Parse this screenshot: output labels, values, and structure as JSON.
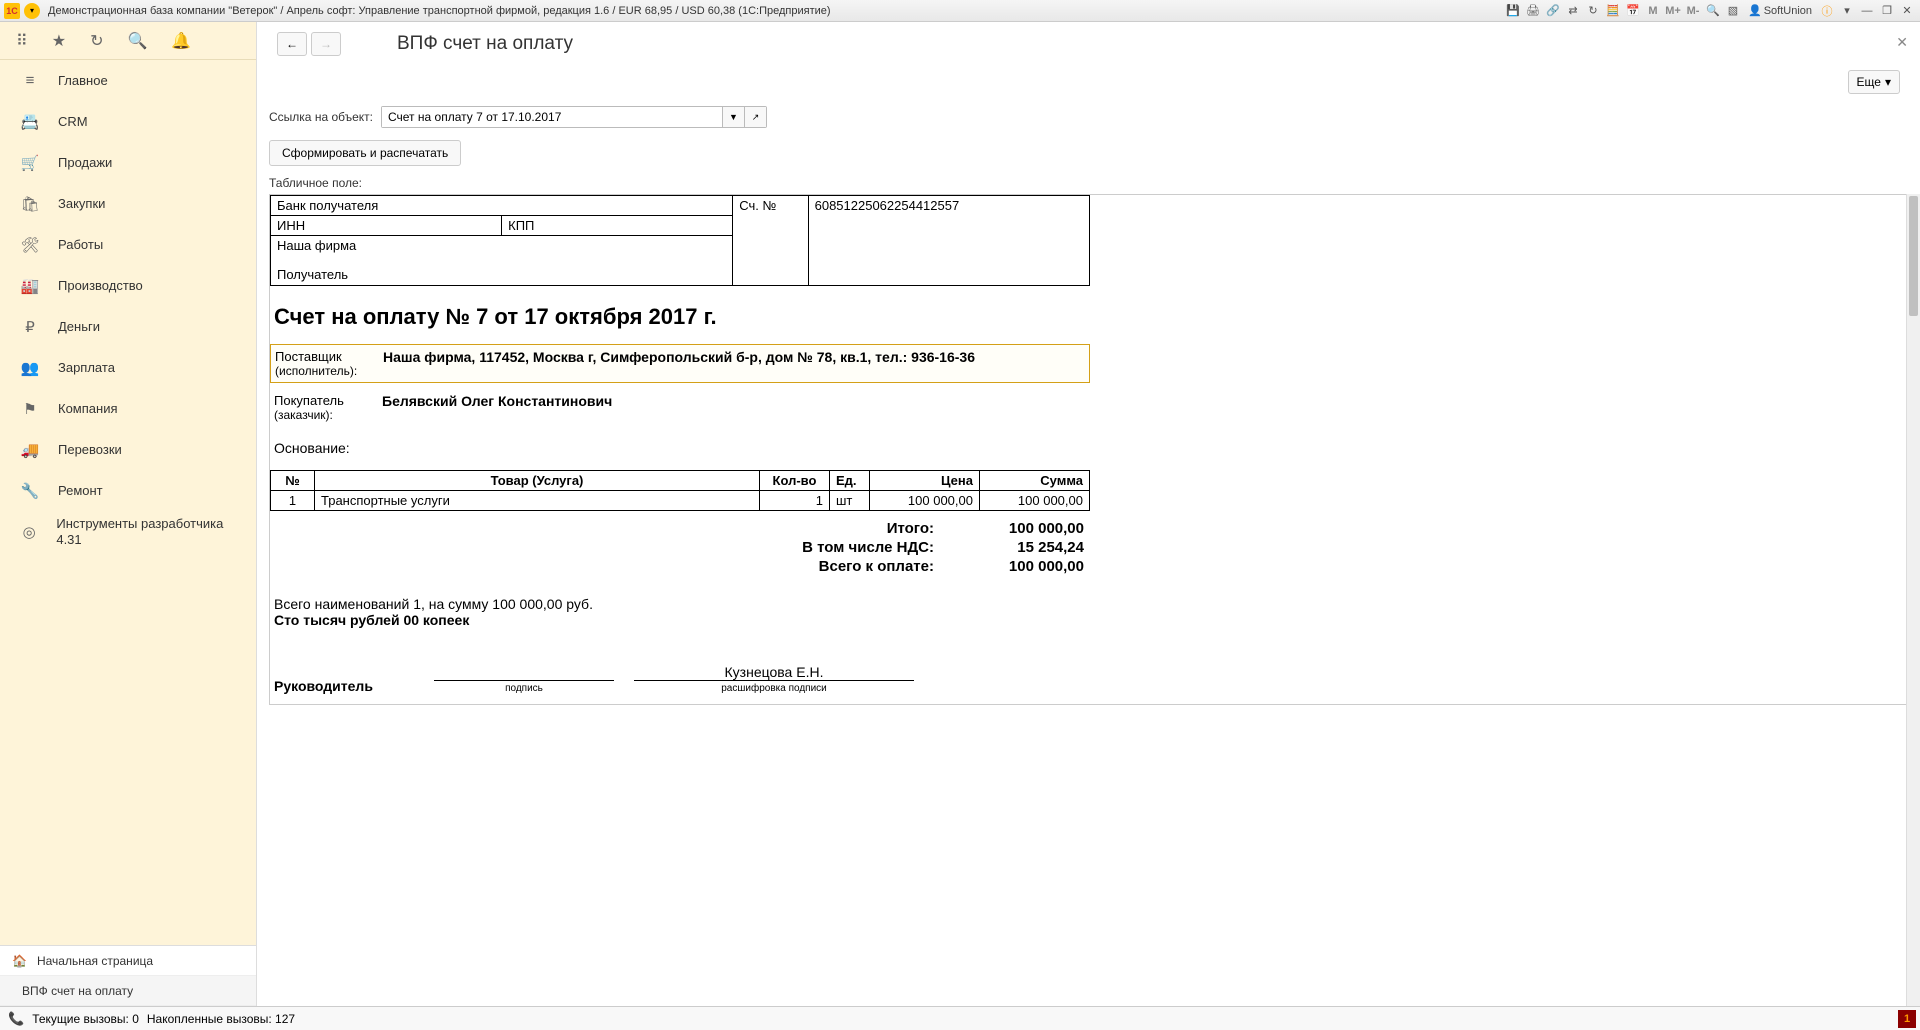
{
  "titlebar": {
    "title": "Демонстрационная база компании \"Ветерок\" / Апрель софт: Управление транспортной фирмой, редакция 1.6 / EUR 68,95 / USD 60,38  (1С:Предприятие)",
    "user": "SoftUnion",
    "mem_labels": [
      "M",
      "M+",
      "M-"
    ]
  },
  "sidebar": {
    "items": [
      {
        "icon": "≡",
        "label": "Главное"
      },
      {
        "icon": "📇",
        "label": "CRM"
      },
      {
        "icon": "🛒",
        "label": "Продажи"
      },
      {
        "icon": "🛍",
        "label": "Закупки"
      },
      {
        "icon": "🛠",
        "label": "Работы"
      },
      {
        "icon": "🏭",
        "label": "Производство"
      },
      {
        "icon": "₽",
        "label": "Деньги"
      },
      {
        "icon": "👥",
        "label": "Зарплата"
      },
      {
        "icon": "⚑",
        "label": "Компания"
      },
      {
        "icon": "🚚",
        "label": "Перевозки"
      },
      {
        "icon": "🔧",
        "label": "Ремонт"
      },
      {
        "icon": "◎",
        "label": "Инструменты разработчика 4.31"
      }
    ],
    "bottom": [
      {
        "icon": "🏠",
        "label": "Начальная страница"
      },
      {
        "icon": "",
        "label": "ВПФ счет на оплату"
      }
    ]
  },
  "page": {
    "title": "ВПФ счет на оплату",
    "more_label": "Еще",
    "ref_label": "Ссылка на объект:",
    "ref_value": "Счет на оплату 7 от 17.10.2017",
    "action_label": "Сформировать и распечатать",
    "field_label": "Табличное поле:"
  },
  "doc": {
    "bank": {
      "recipient_bank_label": "Банк получателя",
      "inn_label": "ИНН",
      "kpp_label": "КПП",
      "account_label": "Сч. №",
      "account_value": "60851225062254412557",
      "firm": "Наша фирма",
      "recipient_label": "Получатель"
    },
    "title": "Счет на оплату № 7 от 17 октября 2017 г.",
    "supplier_label": "Поставщик",
    "supplier_sub": "(исполнитель):",
    "supplier_value": "Наша фирма,  117452, Москва г, Симферопольский б-р, дом № 78, кв.1,  тел.: 936-16-36",
    "buyer_label": "Покупатель",
    "buyer_sub": "(заказчик):",
    "buyer_value": "Белявский Олег Константинович",
    "basis_label": "Основание:",
    "items_header": {
      "num": "№",
      "name": "Товар (Услуга)",
      "qty": "Кол-во",
      "unit": "Ед.",
      "price": "Цена",
      "sum": "Сумма"
    },
    "items": [
      {
        "num": "1",
        "name": "Транспортные услуги",
        "qty": "1",
        "unit": "шт",
        "price": "100 000,00",
        "sum": "100 000,00"
      }
    ],
    "totals": {
      "total_label": "Итого:",
      "total_value": "100 000,00",
      "vat_label": "В том числе НДС:",
      "vat_value": "15 254,24",
      "due_label": "Всего к оплате:",
      "due_value": "100 000,00"
    },
    "summary_line": "Всего наименований 1, на сумму 100 000,00 руб.",
    "summary_words": "Сто тысяч рублей 00 копеек",
    "sign": {
      "leader_label": "Руководитель",
      "sign_caption": "подпись",
      "name": "Кузнецова Е.Н.",
      "decode_caption": "расшифровка подписи"
    }
  },
  "statusbar": {
    "current": "Текущие вызовы: 0",
    "accum": "Накопленные вызовы: 127",
    "red": "1"
  }
}
